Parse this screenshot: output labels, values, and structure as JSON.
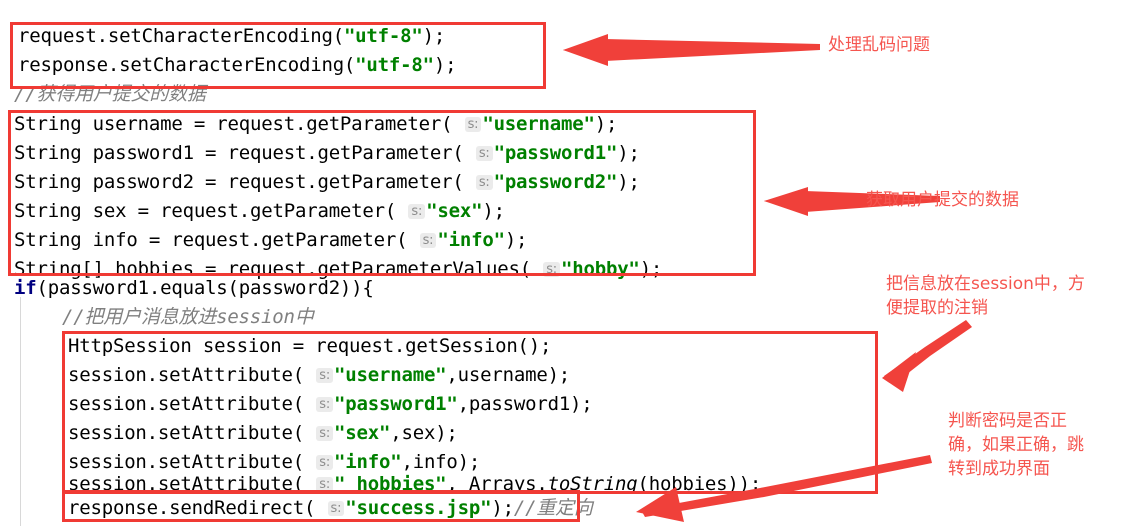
{
  "editor": {
    "language": "java",
    "background_color": "#ffffff",
    "keyword_color": "#000080",
    "string_color": "#008000",
    "comment_color": "#808080",
    "annotation_color": "#f5554f",
    "box_color": "#f03a34",
    "hint_label": "s:",
    "lines": [
      {
        "id": "line-1",
        "indent": 0,
        "text": "request.setCharacterEncoding(\"utf-8\");"
      },
      {
        "id": "line-2",
        "indent": 0,
        "text": "response.setCharacterEncoding(\"utf-8\");"
      },
      {
        "id": "line-3",
        "indent": 0,
        "text": "//获得用户提交的数据"
      },
      {
        "id": "line-4",
        "indent": 0,
        "text": "String username = request.getParameter( s: \"username\");"
      },
      {
        "id": "line-5",
        "indent": 0,
        "text": "String password1 = request.getParameter( s: \"password1\");"
      },
      {
        "id": "line-6",
        "indent": 0,
        "text": "String password2 = request.getParameter( s: \"password2\");"
      },
      {
        "id": "line-7",
        "indent": 0,
        "text": "String sex = request.getParameter( s: \"sex\");"
      },
      {
        "id": "line-8",
        "indent": 0,
        "text": "String info = request.getParameter( s: \"info\");"
      },
      {
        "id": "line-9",
        "indent": 0,
        "text": "String[] hobbies = request.getParameterValues( s: \"hobby\");"
      },
      {
        "id": "line-10",
        "indent": 0,
        "text": "if(password1.equals(password2)){"
      },
      {
        "id": "line-11",
        "indent": 1,
        "text": "//把用户消息放进session中"
      },
      {
        "id": "line-12",
        "indent": 1,
        "text": "HttpSession session = request.getSession();"
      },
      {
        "id": "line-13",
        "indent": 1,
        "text": "session.setAttribute( s: \"username\",username);"
      },
      {
        "id": "line-14",
        "indent": 1,
        "text": "session.setAttribute( s: \"password1\",password1);"
      },
      {
        "id": "line-15",
        "indent": 1,
        "text": "session.setAttribute( s: \"sex\",sex);"
      },
      {
        "id": "line-16",
        "indent": 1,
        "text": "session.setAttribute( s: \"info\",info);"
      },
      {
        "id": "line-17",
        "indent": 1,
        "text": "session.setAttribute( s: \" hobbies\", Arrays.toString(hobbies));"
      },
      {
        "id": "line-18",
        "indent": 1,
        "text": "response.sendRedirect( s: \"success.jsp\");//重定向"
      }
    ]
  },
  "annotations": [
    {
      "id": "annotation-1",
      "text": "处理乱码问题",
      "target": "encoding-box"
    },
    {
      "id": "annotation-2",
      "text": "获取用户提交的数据",
      "target": "get-parameter-box"
    },
    {
      "id": "annotation-3",
      "text": "把信息放在session中，方\n便提取的注销",
      "target": "session-box"
    },
    {
      "id": "annotation-4",
      "text": "判断密码是否正\n确，如果正确，跳\n转到成功界面",
      "target": "redirect-box"
    }
  ],
  "boxes": [
    {
      "id": "encoding-box",
      "label": "encoding-highlight-box"
    },
    {
      "id": "get-parameter-box",
      "label": "get-parameter-highlight-box"
    },
    {
      "id": "session-box",
      "label": "session-highlight-box"
    },
    {
      "id": "redirect-box",
      "label": "redirect-highlight-box"
    }
  ]
}
